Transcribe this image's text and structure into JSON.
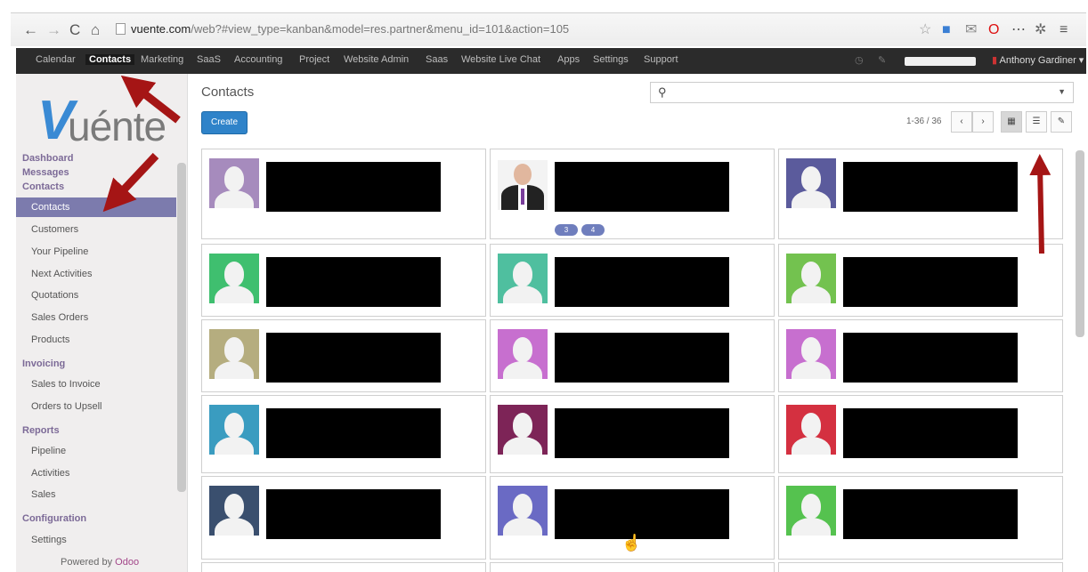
{
  "browser": {
    "url_host": "vuente.com",
    "url_path": "/web?#view_type=kanban&model=res.partner&menu_id=101&action=105"
  },
  "topmenu": {
    "items": [
      "Calendar",
      "Contacts",
      "Marketing",
      "SaaS",
      "Accounting",
      "Project",
      "Website Admin",
      "Saas",
      "Website Live Chat",
      "Apps",
      "Settings",
      "Support"
    ],
    "active": "Contacts",
    "user": "Anthony Gardiner"
  },
  "sidebar": {
    "logo_text": "uénte",
    "headers": {
      "dashboard": "Dashboard",
      "messages": "Messages",
      "contacts": "Contacts",
      "invoicing": "Invoicing",
      "reports": "Reports",
      "configuration": "Configuration"
    },
    "contacts_items": [
      "Contacts",
      "Customers",
      "Your Pipeline",
      "Next Activities",
      "Quotations",
      "Sales Orders",
      "Products"
    ],
    "invoicing_items": [
      "Sales to Invoice",
      "Orders to Upsell"
    ],
    "reports_items": [
      "Pipeline",
      "Activities",
      "Sales"
    ],
    "configuration_items": [
      "Settings"
    ],
    "powered_prefix": "Powered by",
    "powered_brand": "Odoo"
  },
  "main": {
    "title": "Contacts",
    "create_label": "Create",
    "pager": "1-36 / 36",
    "prev": "‹",
    "next": "›"
  },
  "cards": [
    {
      "color": "#a68bbd"
    },
    {
      "photo": true,
      "badges": [
        "3",
        "4"
      ]
    },
    {
      "color": "#5b5b9c"
    },
    {
      "color": "#3fbf6f"
    },
    {
      "color": "#4fbf9f"
    },
    {
      "color": "#73c24f"
    },
    {
      "color": "#b5ad7f"
    },
    {
      "color": "#c76fcf"
    },
    {
      "color": "#c76fcf"
    },
    {
      "color": "#3a9cc0"
    },
    {
      "color": "#7d2457"
    },
    {
      "color": "#d43040"
    },
    {
      "color": "#3a4f6e"
    },
    {
      "color": "#6a6ac4"
    },
    {
      "color": "#55c24f"
    }
  ]
}
